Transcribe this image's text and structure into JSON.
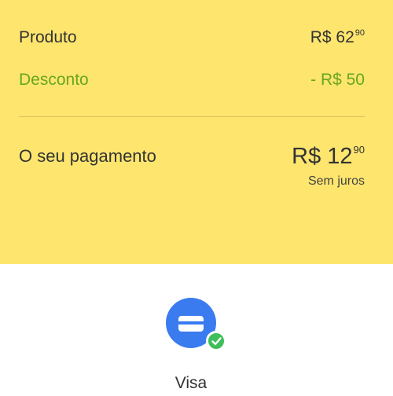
{
  "summary": {
    "product": {
      "label": "Produto",
      "currency": "R$",
      "whole": "62",
      "cents": "90"
    },
    "discount": {
      "label": "Desconto",
      "amount": "- R$ 50"
    },
    "total": {
      "label": "O seu pagamento",
      "currency": "R$",
      "whole": "12",
      "cents": "90",
      "installments": "Sem juros"
    }
  },
  "payment_method": {
    "icon": "credit-card-icon",
    "badge_icon": "check-icon",
    "label": "Visa"
  },
  "colors": {
    "summary_bg": "#fde56e",
    "discount": "#6aa61f",
    "icon_bg": "#3a7bf0",
    "check": "#3fbf5a"
  }
}
